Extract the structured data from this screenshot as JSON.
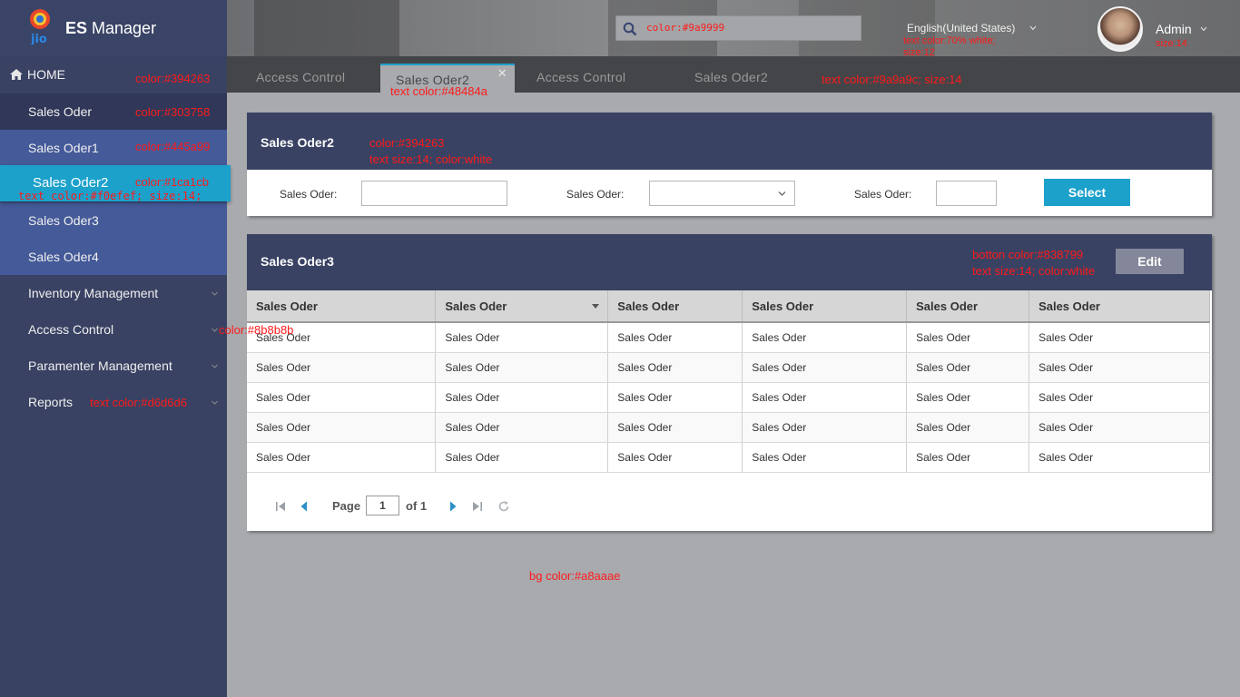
{
  "app": {
    "title_bold": "ES",
    "title_rest": " Manager",
    "logo_text": "jio"
  },
  "sidebar": {
    "home_label": "HOME",
    "items": [
      {
        "label": "Sales Oder"
      },
      {
        "label": "Sales Oder1"
      },
      {
        "label": "Sales Oder2"
      },
      {
        "label": "Sales Oder3"
      },
      {
        "label": "Sales Oder4"
      }
    ],
    "menus": [
      {
        "label": "Inventory Management"
      },
      {
        "label": "Access Control"
      },
      {
        "label": "Paramenter Management"
      },
      {
        "label": "Reports"
      }
    ]
  },
  "header": {
    "search_text": "color:#9a9999",
    "language": "English(United States)",
    "user_name": "Admin"
  },
  "tabs": [
    {
      "label": "Access Control"
    },
    {
      "label": "Sales Oder2",
      "close": "✕"
    },
    {
      "label": "Access Control"
    },
    {
      "label": "Sales Oder2"
    }
  ],
  "filter_panel": {
    "title": "Sales Oder2",
    "field_labels": [
      "Sales Oder:",
      "Sales Oder:",
      "Sales Oder:"
    ],
    "select_button": "Select"
  },
  "table_panel": {
    "title": "Sales Oder3",
    "edit_button": "Edit",
    "columns": [
      "Sales Oder",
      "Sales Oder",
      "Sales Oder",
      "Sales Oder",
      "Sales Oder",
      "Sales Oder"
    ],
    "rows": [
      [
        "Sales Oder",
        "Sales Oder",
        "Sales Oder",
        "Sales Oder",
        "Sales Oder",
        "Sales Oder"
      ],
      [
        "Sales Oder",
        "Sales Oder",
        "Sales Oder",
        "Sales Oder",
        "Sales Oder",
        "Sales Oder"
      ],
      [
        "Sales Oder",
        "Sales Oder",
        "Sales Oder",
        "Sales Oder",
        "Sales Oder",
        "Sales Oder"
      ],
      [
        "Sales Oder",
        "Sales Oder",
        "Sales Oder",
        "Sales Oder",
        "Sales Oder",
        "Sales Oder"
      ],
      [
        "Sales Oder",
        "Sales Oder",
        "Sales Oder",
        "Sales Oder",
        "Sales Oder",
        "Sales Oder"
      ]
    ],
    "pager": {
      "page_word": "Page",
      "page": "1",
      "of_word": "of",
      "total": "1"
    }
  },
  "annotations": {
    "home": "color:#394263",
    "item0": "color:#303758",
    "item1": "color:#445a99",
    "item2": "color:#1ca1cb",
    "item2_text": "text color:#f0efef; size:14;",
    "access": "color:#8b8b8b",
    "reports": "text color:#d6d6d6",
    "tab_active": "text color:#48484a",
    "tabs": "text color:#9a9a9c; size:14",
    "lang_line1": "text color:70% white;",
    "lang_line2": "size:12",
    "user": "size:14",
    "panel1_line1": "color:#394263",
    "panel1_line2": "text size:14; color:white",
    "edit_line1": "botton color:#838799",
    "edit_line2": "text size:14; color:white",
    "bg": "bg color:#a8aaae"
  },
  "colors": {
    "sidebar": "#394263",
    "item_dark": "#303758",
    "item_mid": "#445a99",
    "active": "#1ca1cb",
    "bg": "#a8aaae",
    "edit": "#838799",
    "tab_active_text": "#48484a"
  }
}
